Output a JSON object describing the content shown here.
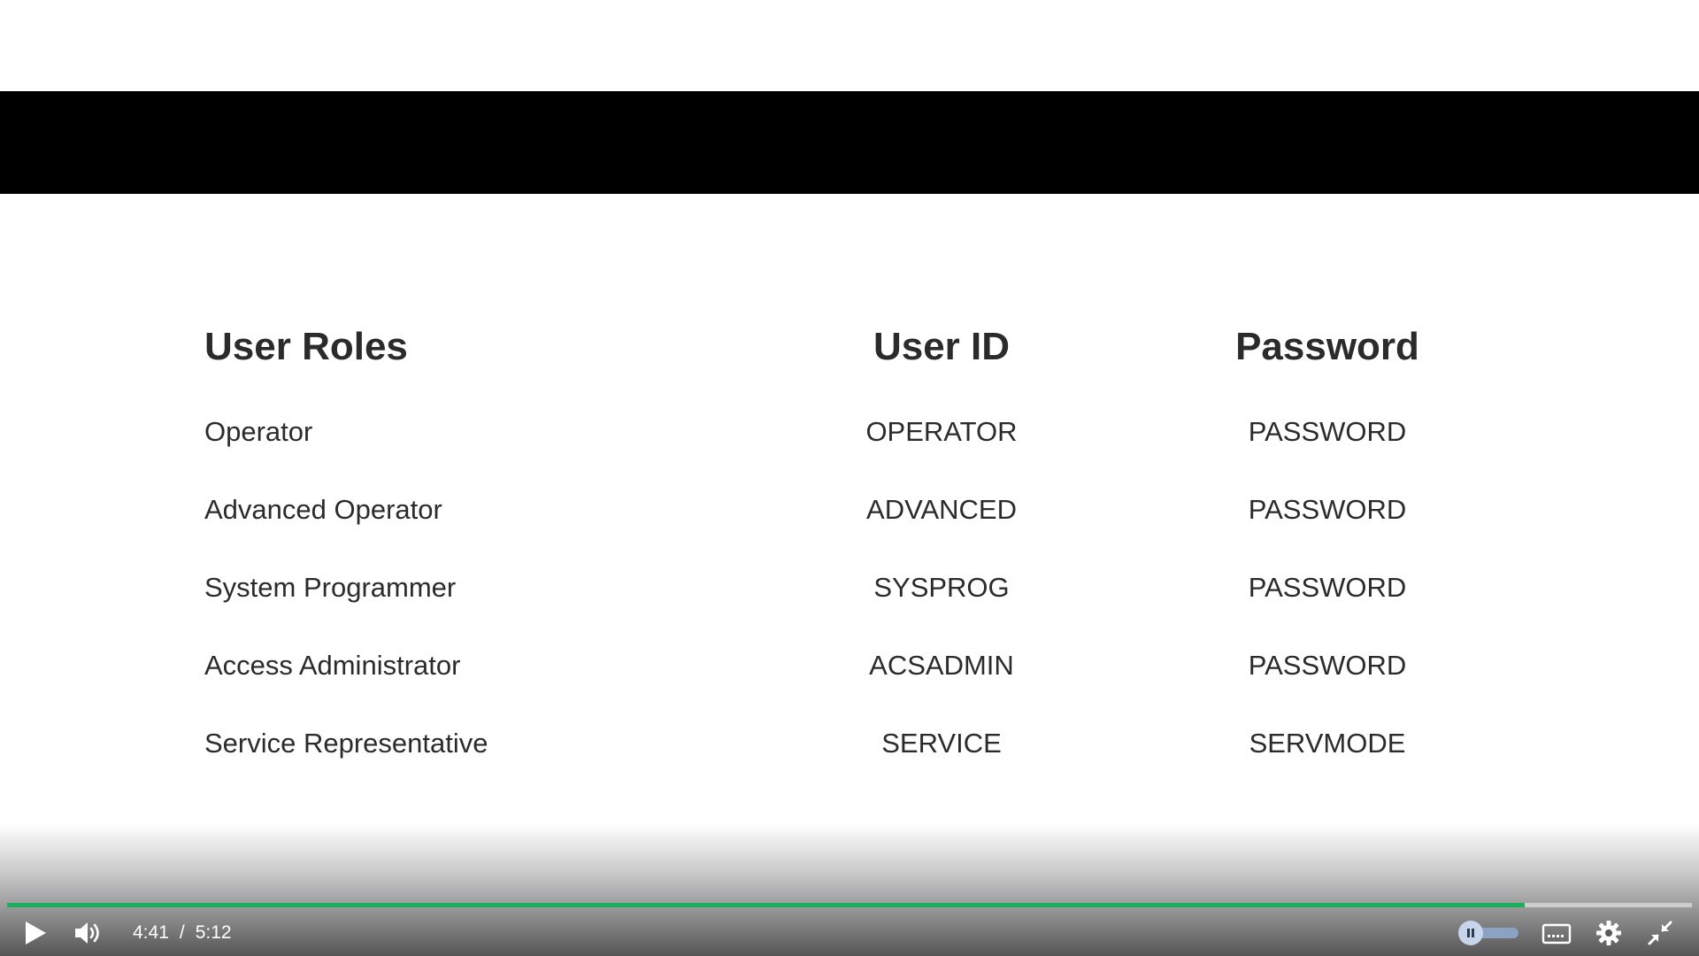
{
  "slide": {
    "headers": {
      "role": "User Roles",
      "user_id": "User ID",
      "password": "Password"
    },
    "rows": [
      {
        "role": "Operator",
        "user_id": "OPERATOR",
        "password": "PASSWORD"
      },
      {
        "role": "Advanced Operator",
        "user_id": "ADVANCED",
        "password": "PASSWORD"
      },
      {
        "role": "System Programmer",
        "user_id": "SYSPROG",
        "password": "PASSWORD"
      },
      {
        "role": "Access Administrator",
        "user_id": "ACSADMIN",
        "password": "PASSWORD"
      },
      {
        "role": "Service Representative",
        "user_id": "SERVICE",
        "password": "SERVMODE"
      }
    ]
  },
  "player": {
    "current_time": "4:41",
    "separator": "/",
    "duration": "5:12",
    "progress_fraction": 0.9006,
    "accent_color": "#1aaf5d",
    "icons": {
      "play": "play-icon",
      "volume": "volume-icon",
      "toggle": "pause-toggle-icon",
      "captions": "captions-icon",
      "settings": "gear-icon",
      "fullscreen": "exit-fullscreen-icon"
    }
  }
}
